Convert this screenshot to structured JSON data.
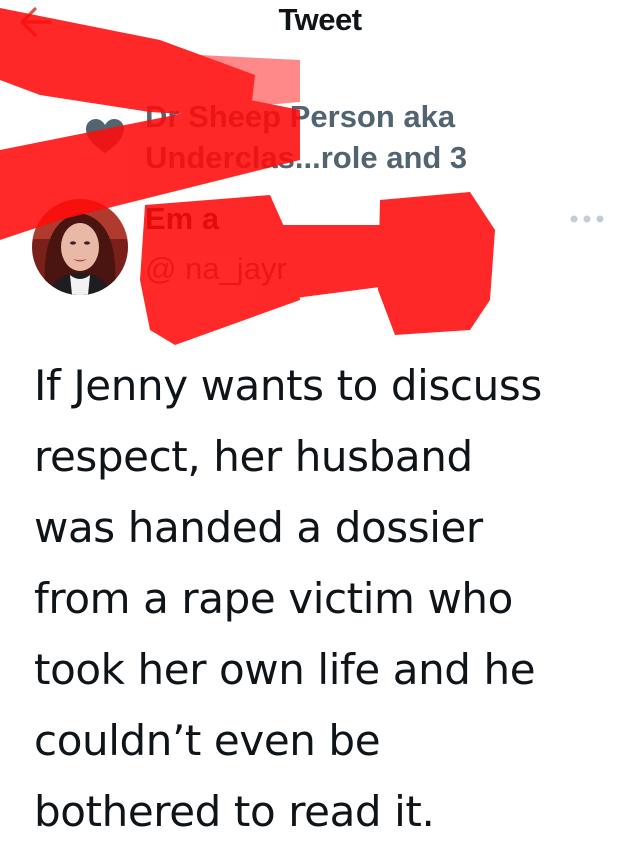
{
  "header": {
    "title": "Tweet",
    "back_icon": "arrow-left-icon"
  },
  "social_context": {
    "icon": "heart-icon",
    "icon_color": "#536471",
    "text": "Dr Sheep Person aka Underclas...role and 3"
  },
  "author": {
    "name": "Em    a",
    "handle": "@     na_jayr",
    "avatar_icon": "profile-photo",
    "more_icon": "more-horizontal-icon"
  },
  "tweet": {
    "text": "If Jenny wants to discuss\nrespect, her husband\nwas handed a dossier\nfrom a rape victim who\ntook her own life and he\ncouldn’t even be\nbothered to read it."
  },
  "colors": {
    "text_primary": "#0f1419",
    "text_secondary": "#536471",
    "redaction": "#ff0b0b",
    "back_arrow": "#e0533f"
  }
}
